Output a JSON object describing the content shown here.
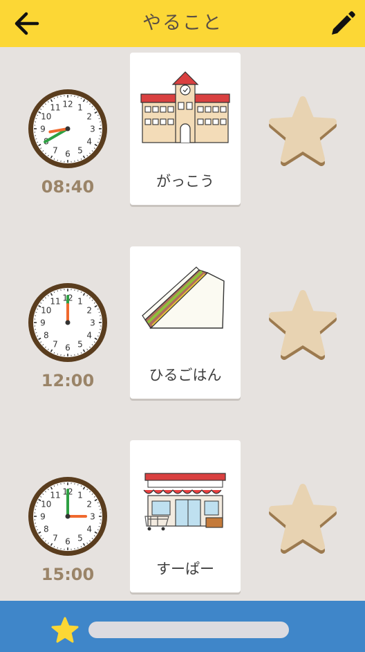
{
  "header": {
    "title": "やること",
    "back_icon": "arrow-left-icon",
    "edit_icon": "pencil-icon"
  },
  "schedule": [
    {
      "time": "08:40",
      "hour": 8,
      "minute": 40,
      "label": "がっこう",
      "picture": "school-building"
    },
    {
      "time": "12:00",
      "hour": 12,
      "minute": 0,
      "label": "ひるごはん",
      "picture": "sandwich"
    },
    {
      "time": "15:00",
      "hour": 15,
      "minute": 0,
      "label": "すーぱー",
      "picture": "supermarket"
    }
  ],
  "footer": {
    "star_icon": "star-icon",
    "progress": 0
  },
  "colors": {
    "header": "#fcd735",
    "background": "#e6e2df",
    "footer": "#3f86c9",
    "clock_rim": "#5a3d1e",
    "hour_hand": "#f0692e",
    "minute_hand": "#2ea043",
    "star": "#e6cfae",
    "time_text": "#9a8468"
  }
}
